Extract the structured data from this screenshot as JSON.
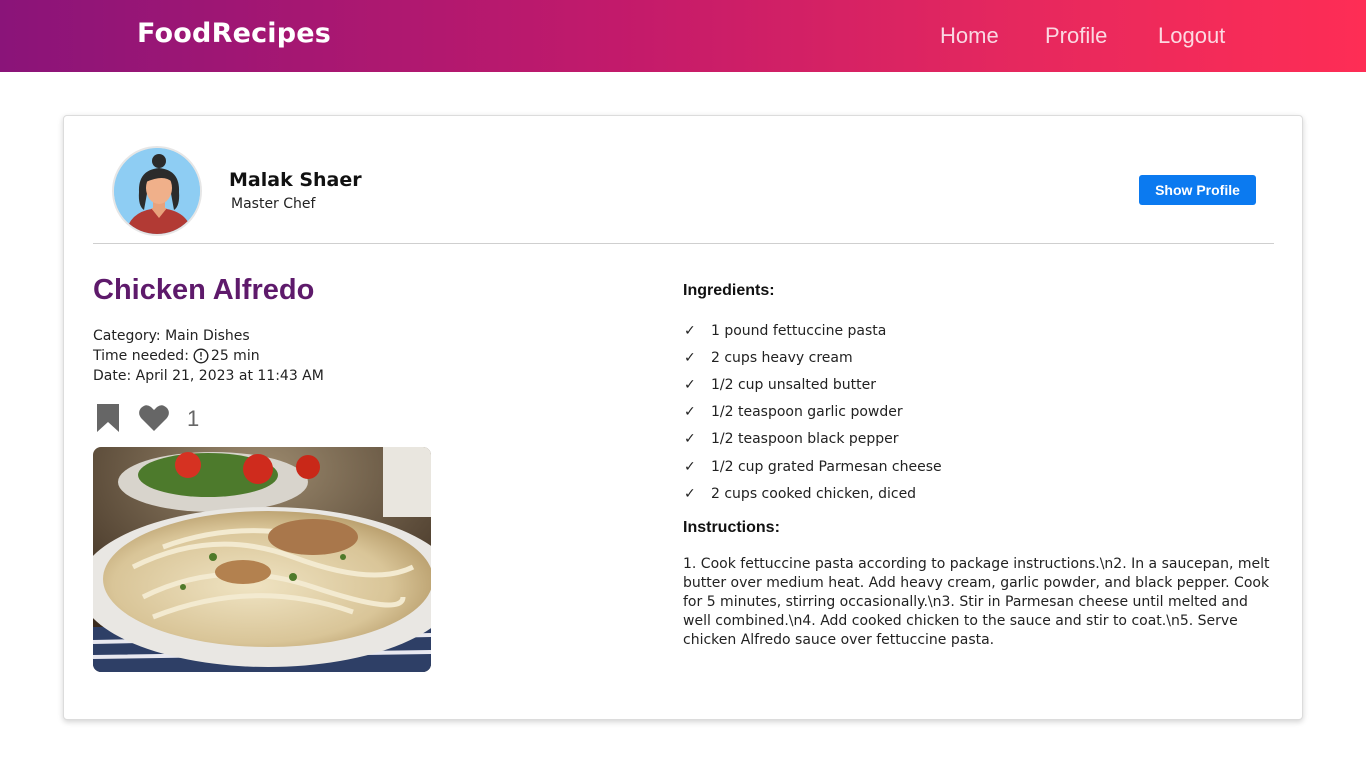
{
  "navbar": {
    "brand": "FoodRecipes",
    "links": [
      "Home",
      "Profile",
      "Logout"
    ],
    "gradient": [
      "#8a1479",
      "#fe2d55"
    ]
  },
  "author": {
    "name": "Malak Shaer",
    "role": "Master Chef",
    "show_profile_label": "Show Profile",
    "button_color": "#0b7af0"
  },
  "recipe": {
    "title": "Chicken Alfredo",
    "title_color": "#5e1a6b",
    "category_line": "Category: Main Dishes",
    "time_label": "Time needed:",
    "time_value": "25 min",
    "date_line": "Date: April 21, 2023 at 11:43 AM",
    "likes": "1",
    "icons": [
      "bookmark-icon",
      "heart-icon",
      "clock-icon"
    ]
  },
  "ingredients": {
    "title": "Ingredients:",
    "check_glyph": "✓",
    "items": [
      "1 pound fettuccine pasta",
      "2 cups heavy cream",
      "1/2 cup unsalted butter",
      "1/2 teaspoon garlic powder",
      "1/2 teaspoon black pepper",
      "1/2 cup grated Parmesan cheese",
      "2 cups cooked chicken, diced"
    ]
  },
  "instructions": {
    "title": "Instructions:",
    "text": "1. Cook fettuccine pasta according to package instructions.\\n2. In a saucepan, melt butter over medium heat. Add heavy cream, garlic powder, and black pepper. Cook for 5 minutes, stirring occasionally.\\n3. Stir in Parmesan cheese until melted and well combined.\\n4. Add cooked chicken to the sauce and stir to coat.\\n5. Serve chicken Alfredo sauce over fettuccine pasta."
  }
}
